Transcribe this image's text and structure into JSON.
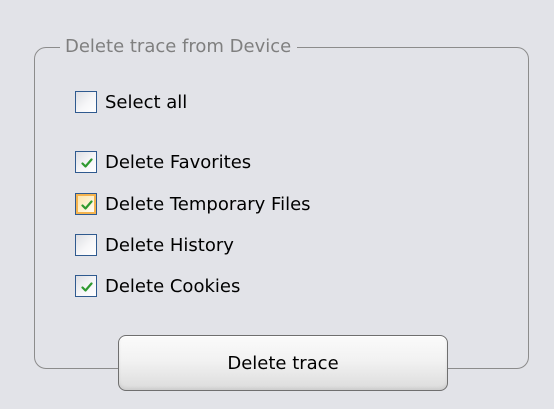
{
  "group": {
    "title": "Delete trace from Device"
  },
  "select_all": {
    "label": "Select all",
    "checked": false
  },
  "options": [
    {
      "label": "Delete Favorites",
      "checked": true,
      "focused": false
    },
    {
      "label": "Delete Temporary Files",
      "checked": true,
      "focused": true
    },
    {
      "label": "Delete History",
      "checked": false,
      "focused": false
    },
    {
      "label": "Delete Cookies",
      "checked": true,
      "focused": false
    }
  ],
  "action": {
    "label": "Delete trace"
  },
  "colors": {
    "background": "#e2e3e8",
    "check": "#2f9a2f",
    "focus": "#f4b34e"
  },
  "icons": {
    "checkmark": "check-icon"
  }
}
